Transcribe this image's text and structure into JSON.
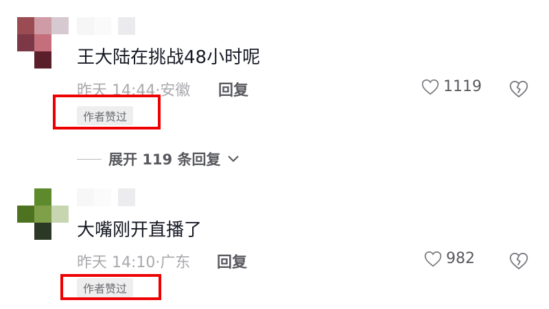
{
  "comments": [
    {
      "text": "王大陆在挑战48小时呢",
      "time": "昨天 14:44",
      "location": "安徽",
      "reply_label": "回复",
      "like_count": "1119",
      "author_badge": "作者赞过",
      "avatar_colors": [
        "#9b4c52",
        "#cf9ba6",
        "#d6c9cf",
        "#7d3848",
        "#c56f7c",
        "#ffffff",
        "#ffffff",
        "#5a1f2a",
        "#ffffff"
      ]
    },
    {
      "text": "大嘴刚开直播了",
      "time": "昨天 14:10",
      "location": "广东",
      "reply_label": "回复",
      "like_count": "982",
      "author_badge": "作者赞过",
      "avatar_colors": [
        "#ffffff",
        "#5d8a2c",
        "#ffffff",
        "#4d7320",
        "#7fa048",
        "#c7d6b0",
        "#ffffff",
        "#2c3826",
        "#ffffff"
      ]
    }
  ],
  "expand_replies": {
    "label": "展开 119 条回复"
  },
  "icons": {
    "like": "heart-outline-icon",
    "dislike": "broken-heart-outline-icon",
    "expand": "chevron-down-icon"
  },
  "colors": {
    "highlight_box": "#ee0000",
    "meta_text": "#a8a9ad",
    "primary_text": "#161823"
  }
}
